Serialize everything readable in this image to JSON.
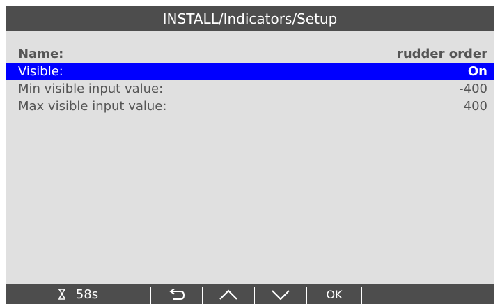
{
  "header": {
    "title": "INSTALL/Indicators/Setup"
  },
  "settings": [
    {
      "label": "Name:",
      "value": "rudder order",
      "state": "bold"
    },
    {
      "label": "Visible:",
      "value": "On",
      "state": "selected"
    },
    {
      "label": "Min visible input value:",
      "value": "-400",
      "state": "normal"
    },
    {
      "label": "Max visible input value:",
      "value": "400",
      "state": "normal"
    }
  ],
  "footer": {
    "timer_icon": "hourglass-icon",
    "timer_value": "58s",
    "buttons": [
      {
        "icon": "back-arrow-icon"
      },
      {
        "icon": "chevron-up-icon"
      },
      {
        "icon": "chevron-down-icon"
      },
      {
        "icon": "ok",
        "label": "OK"
      }
    ]
  },
  "colors": {
    "title_bg": "#4d4d4d",
    "screen_bg": "#e0e0e0",
    "selected_bg": "#0000ff",
    "text": "#555555"
  }
}
